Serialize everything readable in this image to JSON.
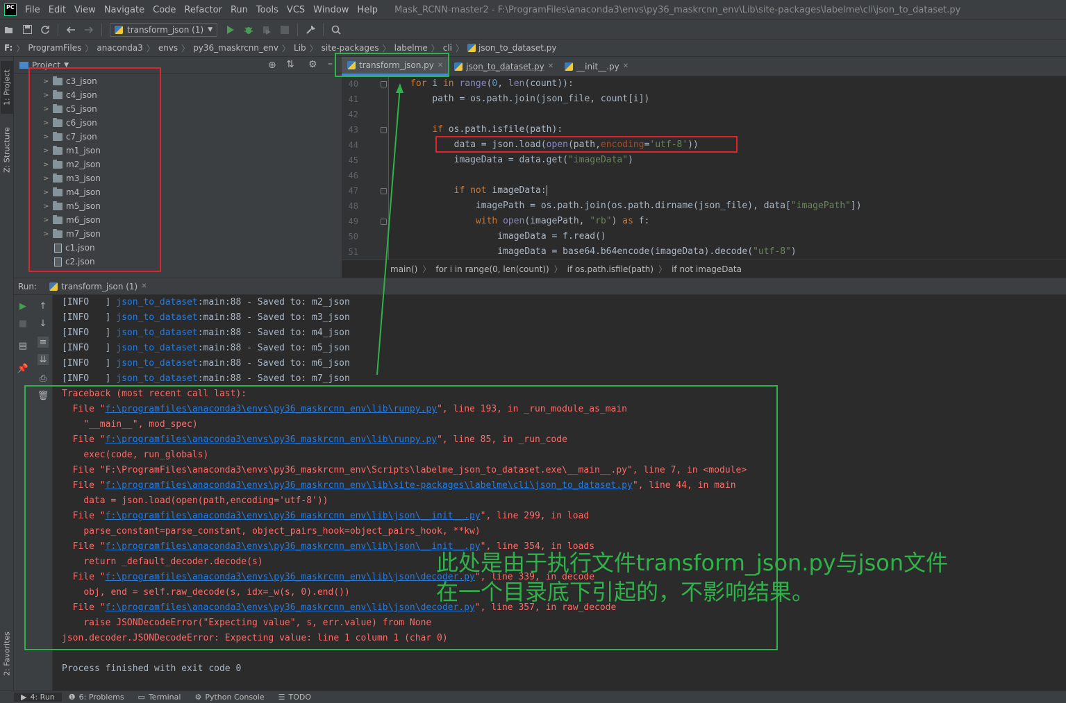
{
  "menubar": {
    "logo": "PC",
    "items": [
      "File",
      "Edit",
      "View",
      "Navigate",
      "Code",
      "Refactor",
      "Run",
      "Tools",
      "VCS",
      "Window",
      "Help"
    ],
    "title": "Mask_RCNN-master2 - F:\\ProgramFiles\\anaconda3\\envs\\py36_maskrcnn_env\\Lib\\site-packages\\labelme\\cli\\json_to_dataset.py"
  },
  "toolbar": {
    "run_config": "transform_json (1)",
    "icons": [
      "open-icon",
      "save-icon",
      "sync-icon",
      "back-icon",
      "forward-icon",
      "run-icon",
      "debug-icon",
      "coverage-icon",
      "stop-icon",
      "wrench-icon",
      "search-icon"
    ]
  },
  "navbar": {
    "drive": "F:",
    "crumbs": [
      "ProgramFiles",
      "anaconda3",
      "envs",
      "py36_maskrcnn_env",
      "Lib",
      "site-packages",
      "labelme",
      "cli",
      "json_to_dataset.py"
    ]
  },
  "left_strip": {
    "project_tab": "1: Project",
    "structure_tab": "Z: Structure",
    "favorites_tab": "2: Favorites"
  },
  "project": {
    "title": "Project",
    "folders": [
      "c3_json",
      "c4_json",
      "c5_json",
      "c6_json",
      "c7_json",
      "m1_json",
      "m2_json",
      "m3_json",
      "m4_json",
      "m5_json",
      "m6_json",
      "m7_json"
    ],
    "files": [
      "c1.json",
      "c2.json"
    ]
  },
  "editor_tabs": [
    {
      "label": "transform_json.py",
      "active": true
    },
    {
      "label": "json_to_dataset.py",
      "active": false
    },
    {
      "label": "__init__.py",
      "active": false
    }
  ],
  "editor": {
    "line_numbers": [
      "40",
      "41",
      "42",
      "43",
      "44",
      "45",
      "46",
      "47",
      "48",
      "49",
      "50",
      "51"
    ],
    "breadcrumb": [
      "main()",
      "for i in range(0, len(count))",
      "if os.path.isfile(path)",
      "if not imageData"
    ]
  },
  "run": {
    "label": "Run:",
    "tab": "transform_json (1)",
    "info_lines": [
      {
        "prefix": "[INFO   ] ",
        "module": "json_to_dataset",
        "suffix": ":main:88 - Saved to: m2_json"
      },
      {
        "prefix": "[INFO   ] ",
        "module": "json_to_dataset",
        "suffix": ":main:88 - Saved to: m3_json"
      },
      {
        "prefix": "[INFO   ] ",
        "module": "json_to_dataset",
        "suffix": ":main:88 - Saved to: m4_json"
      },
      {
        "prefix": "[INFO   ] ",
        "module": "json_to_dataset",
        "suffix": ":main:88 - Saved to: m5_json"
      },
      {
        "prefix": "[INFO   ] ",
        "module": "json_to_dataset",
        "suffix": ":main:88 - Saved to: m6_json"
      },
      {
        "prefix": "[INFO   ] ",
        "module": "json_to_dataset",
        "suffix": ":main:88 - Saved to: m7_json"
      }
    ],
    "traceback": [
      {
        "indent": "",
        "text": "Traceback (most recent call last):"
      },
      {
        "indent": "  ",
        "pre": "File \"",
        "link": "f:\\programfiles\\anaconda3\\envs\\py36_maskrcnn_env\\lib\\runpy.py",
        "post": "\", line 193, in _run_module_as_main"
      },
      {
        "indent": "    ",
        "text": "\"__main__\", mod_spec)"
      },
      {
        "indent": "  ",
        "pre": "File \"",
        "link": "f:\\programfiles\\anaconda3\\envs\\py36_maskrcnn_env\\lib\\runpy.py",
        "post": "\", line 85, in _run_code"
      },
      {
        "indent": "    ",
        "text": "exec(code, run_globals)"
      },
      {
        "indent": "  ",
        "text": "File \"F:\\ProgramFiles\\anaconda3\\envs\\py36_maskrcnn_env\\Scripts\\labelme_json_to_dataset.exe\\__main__.py\", line 7, in <module>"
      },
      {
        "indent": "  ",
        "pre": "File \"",
        "link": "f:\\programfiles\\anaconda3\\envs\\py36_maskrcnn_env\\lib\\site-packages\\labelme\\cli\\json_to_dataset.py",
        "post": "\", line 44, in main"
      },
      {
        "indent": "    ",
        "text": "data = json.load(open(path,encoding='utf-8'))"
      },
      {
        "indent": "  ",
        "pre": "File \"",
        "link": "f:\\programfiles\\anaconda3\\envs\\py36_maskrcnn_env\\lib\\json\\__init__.py",
        "post": "\", line 299, in load"
      },
      {
        "indent": "    ",
        "text": "parse_constant=parse_constant, object_pairs_hook=object_pairs_hook, **kw)"
      },
      {
        "indent": "  ",
        "pre": "File \"",
        "link": "f:\\programfiles\\anaconda3\\envs\\py36_maskrcnn_env\\lib\\json\\__init__.py",
        "post": "\", line 354, in loads"
      },
      {
        "indent": "    ",
        "text": "return _default_decoder.decode(s)"
      },
      {
        "indent": "  ",
        "pre": "File \"",
        "link": "f:\\programfiles\\anaconda3\\envs\\py36_maskrcnn_env\\lib\\json\\decoder.py",
        "post": "\", line 339, in decode"
      },
      {
        "indent": "    ",
        "text": "obj, end = self.raw_decode(s, idx=_w(s, 0).end())"
      },
      {
        "indent": "  ",
        "pre": "File \"",
        "link": "f:\\programfiles\\anaconda3\\envs\\py36_maskrcnn_env\\lib\\json\\decoder.py",
        "post": "\", line 357, in raw_decode"
      },
      {
        "indent": "    ",
        "text": "raise JSONDecodeError(\"Expecting value\", s, err.value) from None"
      },
      {
        "indent": "",
        "text": "json.decoder.JSONDecodeError: Expecting value: line 1 column 1 (char 0)"
      }
    ],
    "exit_message": "Process finished with exit code 0"
  },
  "annotation": {
    "line1": "此处是由于执行文件transform_json.py与json文件",
    "line2": "在一个目录底下引起的，不影响结果。"
  },
  "bottom_bar": [
    {
      "label": "4: Run",
      "icon": "play-icon",
      "active": true
    },
    {
      "label": "6: Problems",
      "icon": "problems-icon",
      "active": false
    },
    {
      "label": "Terminal",
      "icon": "terminal-icon",
      "active": false
    },
    {
      "label": "Python Console",
      "icon": "python-icon",
      "active": false
    },
    {
      "label": "TODO",
      "icon": "list-icon",
      "active": false
    }
  ],
  "colors": {
    "annotation_red": "#e0242b",
    "annotation_green": "#2fb24a",
    "error_text": "#ff6b68",
    "link": "#287bde"
  }
}
